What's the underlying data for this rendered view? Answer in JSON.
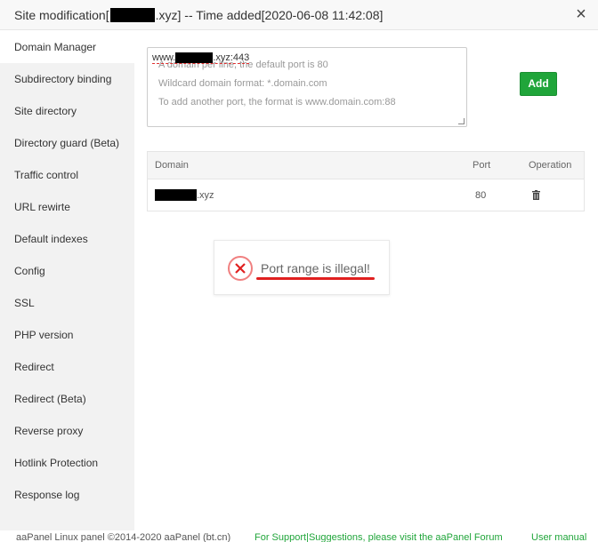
{
  "dialog": {
    "title_prefix": "Site modification[",
    "title_suffix": ".xyz] -- Time added[2020-06-08 11:42:08]",
    "close_glyph": "×"
  },
  "sidebar": {
    "items": [
      {
        "label": "Domain Manager",
        "active": true
      },
      {
        "label": "Subdirectory binding"
      },
      {
        "label": "Site directory"
      },
      {
        "label": "Directory guard (Beta)"
      },
      {
        "label": "Traffic control"
      },
      {
        "label": "URL rewirte"
      },
      {
        "label": "Default indexes"
      },
      {
        "label": "Config"
      },
      {
        "label": "SSL"
      },
      {
        "label": "PHP version"
      },
      {
        "label": "Redirect"
      },
      {
        "label": "Redirect (Beta)"
      },
      {
        "label": "Reverse proxy"
      },
      {
        "label": "Hotlink Protection"
      },
      {
        "label": "Response log"
      }
    ]
  },
  "domain_form": {
    "value_prefix": "www.",
    "value_suffix": ".xyz:443",
    "placeholder_lines": [
      "A domain per line, the default port is 80",
      "Wildcard domain format: *.domain.com",
      "To add another port, the format is www.domain.com:88"
    ],
    "add_label": "Add"
  },
  "domain_table": {
    "headers": {
      "domain": "Domain",
      "port": "Port",
      "operation": "Operation"
    },
    "rows": [
      {
        "domain_suffix": ".xyz",
        "port": "80"
      }
    ]
  },
  "toast": {
    "message": "Port range is illegal!",
    "icon": "error-x-icon",
    "color": "#e02020"
  },
  "footer": {
    "left": "aaPanel Linux panel ©2014-2020 aaPanel (bt.cn)",
    "middle": "For Support|Suggestions, please visit the aaPanel Forum",
    "right": "User manual"
  },
  "colors": {
    "accent": "#20a53a",
    "sidebar_bg": "#f2f2f2",
    "error": "#e02020"
  }
}
